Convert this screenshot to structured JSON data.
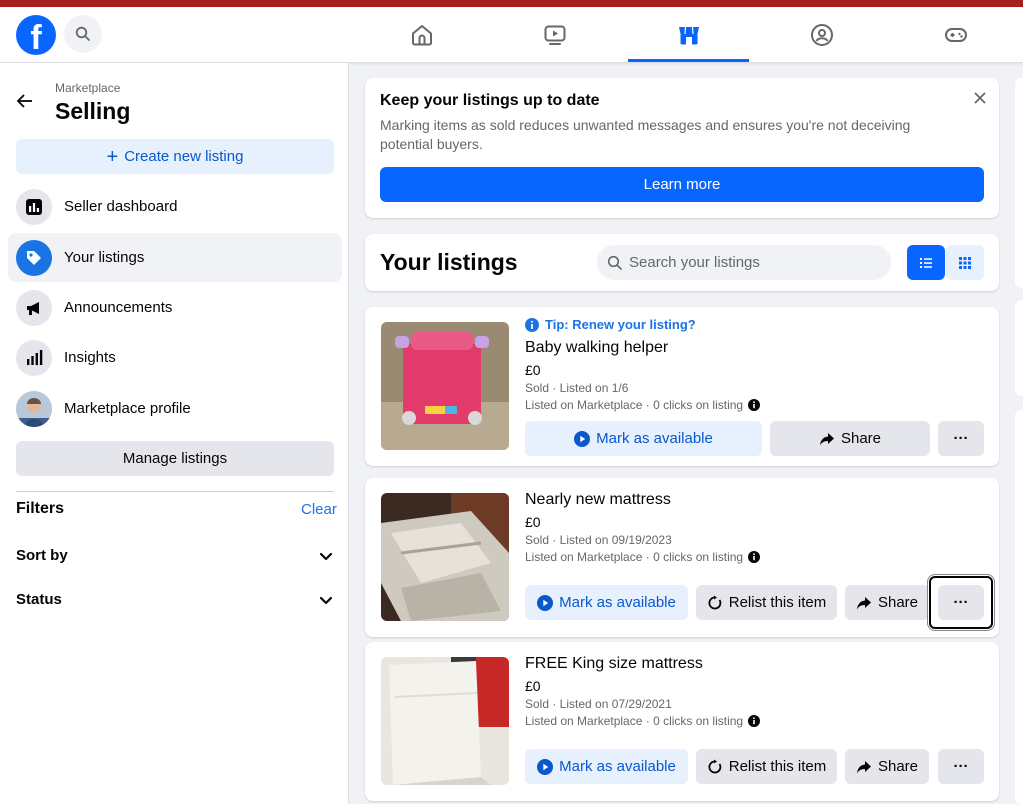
{
  "colors": {
    "brand": "#0866ff",
    "link": "#1b74e4",
    "accent_light": "#e7f0fd",
    "top_strip": "#a51f21"
  },
  "topnav": {
    "tabs": [
      {
        "icon": "home-icon"
      },
      {
        "icon": "video-icon"
      },
      {
        "icon": "marketplace-icon",
        "active": true
      },
      {
        "icon": "groups-icon"
      },
      {
        "icon": "gaming-icon"
      }
    ]
  },
  "sidebar": {
    "breadcrumb": "Marketplace",
    "title": "Selling",
    "create_label": "Create new listing",
    "items": [
      {
        "label": "Seller dashboard",
        "icon": "dashboard-icon"
      },
      {
        "label": "Your listings",
        "icon": "tag-icon",
        "active": true
      },
      {
        "label": "Announcements",
        "icon": "megaphone-icon"
      },
      {
        "label": "Insights",
        "icon": "bar-chart-icon"
      },
      {
        "label": "Marketplace profile",
        "icon": "avatar"
      }
    ],
    "manage_label": "Manage listings",
    "filters_label": "Filters",
    "clear_label": "Clear",
    "sort_label": "Sort by",
    "status_label": "Status"
  },
  "banner": {
    "title": "Keep your listings up to date",
    "text": "Marking items as sold reduces unwanted messages and ensures you're not deceiving potential buyers.",
    "button": "Learn more"
  },
  "list_header": {
    "title": "Your listings",
    "search_placeholder": "Search your listings"
  },
  "listings": [
    {
      "tip": "Tip: Renew your listing?",
      "title": "Baby walking helper",
      "price": "£0",
      "status": "Sold · Listed on 1/6",
      "stats": "Listed on Marketplace · 0 clicks on listing",
      "mark_label": "Mark as available",
      "share_label": "Share",
      "more_label": "···"
    },
    {
      "title": "Nearly new mattress",
      "price": "£0",
      "status": "Sold · Listed on 09/19/2023",
      "stats": "Listed on Marketplace · 0 clicks on listing",
      "mark_label": "Mark as available",
      "relist_label": "Relist this item",
      "share_label": "Share",
      "more_label": "···"
    },
    {
      "title": "FREE King size mattress",
      "price": "£0",
      "status": "Sold · Listed on 07/29/2021",
      "stats": "Listed on Marketplace · 0 clicks on listing",
      "mark_label": "Mark as available",
      "relist_label": "Relist this item",
      "share_label": "Share",
      "more_label": "···"
    }
  ]
}
